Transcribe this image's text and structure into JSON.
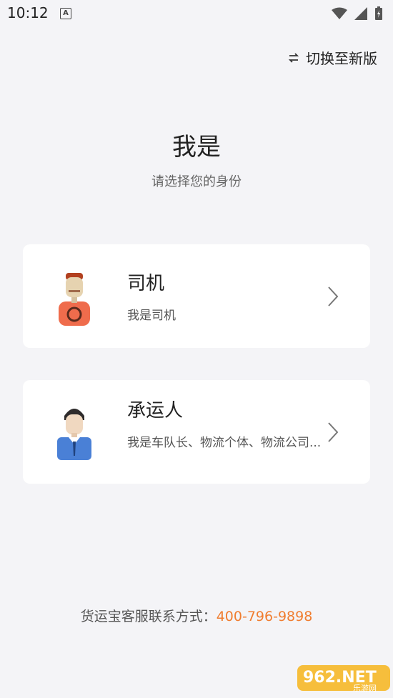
{
  "status": {
    "time": "10:12",
    "a_icon": "A"
  },
  "header": {
    "switch_label": "切换至新版"
  },
  "title": "我是",
  "subtitle": "请选择您的身份",
  "roles": [
    {
      "title": "司机",
      "desc": "我是司机"
    },
    {
      "title": "承运人",
      "desc": "我是车队长、物流个体、物流公司..."
    }
  ],
  "footer": {
    "label": "货运宝客服联系方式：",
    "phone": "400-796-9898"
  },
  "watermark": {
    "text": "962.NET",
    "sub": "乐游网"
  },
  "colors": {
    "accent": "#f07d2f",
    "bg": "#f4f4f7"
  }
}
